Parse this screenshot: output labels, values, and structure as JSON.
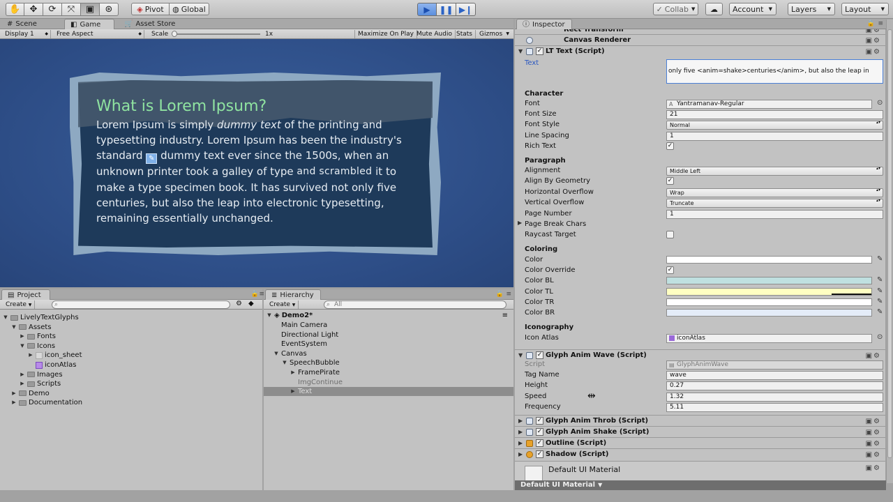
{
  "toolbar": {
    "tools": [
      "hand-icon",
      "move-icon",
      "rotate-icon",
      "scale-icon",
      "rect-icon",
      "transform-icon"
    ],
    "pivot": "Pivot",
    "global": "Global",
    "collab": "Collab",
    "account": "Account",
    "layers": "Layers",
    "layout": "Layout"
  },
  "scene_tabs": {
    "scene": "Scene",
    "game": "Game",
    "asset_store": "Asset Store"
  },
  "game_bar": {
    "display": "Display 1",
    "aspect": "Free Aspect",
    "scale_label": "Scale",
    "scale_value": "1x",
    "maximize": "Maximize On Play",
    "mute": "Mute Audio",
    "stats": "Stats",
    "gizmos": "Gizmos"
  },
  "bubble": {
    "title": "What is Lorem Ipsum?",
    "line1a": "Lorem Ipsum is simply ",
    "line1b": "dummy text",
    "line1c": " of the printing and",
    "line2": "typesetting industry. Lorem Ipsum has been the industry's",
    "line3a": "standard ",
    "line3b": " dummy text ever since the 1500s, when an",
    "line4a": "unknown printer took a galley of type ",
    "line4b": "and scrambled",
    "line4c": " it to",
    "line5": "make a type specimen book. It has survived not only five",
    "line6": "centuries, but also the leap into electronic typesetting,",
    "line7": "remaining essentially unchanged."
  },
  "project": {
    "tab": "Project",
    "create": "Create",
    "items": [
      {
        "label": "LivelyTextGlyphs",
        "depth": 0,
        "arrow": "▼"
      },
      {
        "label": "Assets",
        "depth": 1,
        "arrow": "▼"
      },
      {
        "label": "Fonts",
        "depth": 2,
        "arrow": "▶"
      },
      {
        "label": "Icons",
        "depth": 2,
        "arrow": "▼"
      },
      {
        "label": "icon_sheet",
        "depth": 3,
        "arrow": "▶"
      },
      {
        "label": "iconAtlas",
        "depth": 3,
        "arrow": ""
      },
      {
        "label": "Images",
        "depth": 2,
        "arrow": "▶"
      },
      {
        "label": "Scripts",
        "depth": 2,
        "arrow": "▶"
      },
      {
        "label": "Demo",
        "depth": 1,
        "arrow": "▶"
      },
      {
        "label": "Documentation",
        "depth": 1,
        "arrow": "▶"
      }
    ]
  },
  "hierarchy": {
    "tab": "Hierarchy",
    "create": "Create",
    "search_placeholder": "All",
    "scene": "Demo2*",
    "items": [
      {
        "label": "Main Camera",
        "depth": 1,
        "arrow": "",
        "dim": false
      },
      {
        "label": "Directional Light",
        "depth": 1,
        "arrow": "",
        "dim": false
      },
      {
        "label": "EventSystem",
        "depth": 1,
        "arrow": "",
        "dim": false
      },
      {
        "label": "Canvas",
        "depth": 1,
        "arrow": "▼",
        "dim": false
      },
      {
        "label": "SpeechBubble",
        "depth": 2,
        "arrow": "▼",
        "dim": false
      },
      {
        "label": "FramePirate",
        "depth": 3,
        "arrow": "▶",
        "dim": false
      },
      {
        "label": "ImgContinue",
        "depth": 3,
        "arrow": "",
        "dim": true
      },
      {
        "label": "Text",
        "depth": 3,
        "arrow": "▶",
        "dim": true,
        "selected": true
      }
    ]
  },
  "inspector": {
    "tab": "Inspector",
    "rect_transform": "Rect Transform",
    "canvas_renderer": "Canvas Renderer",
    "lt_text": "LT Text (Script)",
    "text_label": "Text",
    "text_value": "only five <anim=shake>centuries</anim>, but also the leap in",
    "character": "Character",
    "font_label": "Font",
    "font_value": "Yantramanav-Regular",
    "font_size_label": "Font Size",
    "font_size_value": "21",
    "font_style_label": "Font Style",
    "font_style_value": "Normal",
    "line_spacing_label": "Line Spacing",
    "line_spacing_value": "1",
    "rich_text_label": "Rich Text",
    "paragraph": "Paragraph",
    "alignment_label": "Alignment",
    "alignment_value": "Middle Left",
    "align_geom_label": "Align By Geometry",
    "h_overflow_label": "Horizontal Overflow",
    "h_overflow_value": "Wrap",
    "v_overflow_label": "Vertical Overflow",
    "v_overflow_value": "Truncate",
    "page_number_label": "Page Number",
    "page_number_value": "1",
    "page_break_label": "Page Break Chars",
    "raycast_label": "Raycast Target",
    "coloring": "Coloring",
    "color_label": "Color",
    "color_override_label": "Color Override",
    "color_bl_label": "Color BL",
    "color_tl_label": "Color TL",
    "color_tr_label": "Color TR",
    "color_br_label": "Color BR",
    "iconography": "Iconography",
    "icon_atlas_label": "Icon Atlas",
    "icon_atlas_value": "iconAtlas",
    "glyph_wave": "Glyph Anim Wave (Script)",
    "script_label": "Script",
    "script_value": "GlyphAnimWave",
    "tag_name_label": "Tag Name",
    "tag_name_value": "wave",
    "height_label": "Height",
    "height_value": "0.27",
    "speed_label": "Speed",
    "speed_value": "1.32",
    "frequency_label": "Frequency",
    "frequency_value": "5.11",
    "glyph_throb": "Glyph Anim Throb (Script)",
    "glyph_shake": "Glyph Anim Shake (Script)",
    "outline": "Outline (Script)",
    "shadow": "Shadow (Script)",
    "material": "Default UI Material",
    "material_bar": "Default UI Material"
  },
  "colors": {
    "color": "#ffffff",
    "color_bl": "#bfe0e0",
    "color_tl": "#ffffc2",
    "color_tr": "#ffffff",
    "color_br": "#e4ecf8",
    "game_bg": "#2d4d86",
    "title_green": "#8fe3a0"
  }
}
